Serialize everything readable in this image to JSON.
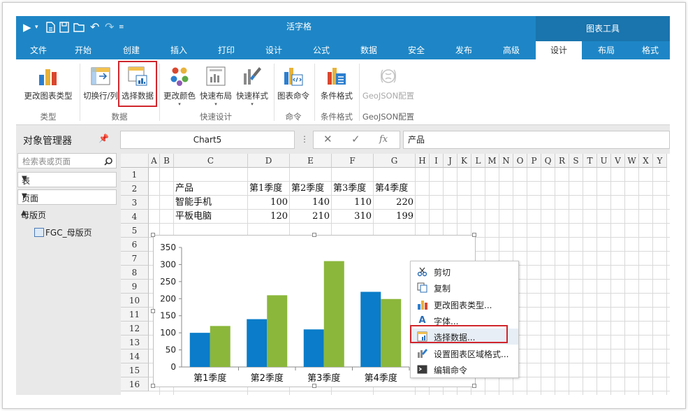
{
  "app": {
    "title": "活字格",
    "context_header": "图表工具"
  },
  "tabs": [
    {
      "label": "文件"
    },
    {
      "label": "开始"
    },
    {
      "label": "创建"
    },
    {
      "label": "插入"
    },
    {
      "label": "打印"
    },
    {
      "label": "设计"
    },
    {
      "label": "公式"
    },
    {
      "label": "数据"
    },
    {
      "label": "安全"
    },
    {
      "label": "发布"
    },
    {
      "label": "高级"
    },
    {
      "label": "设计"
    },
    {
      "label": "布局"
    },
    {
      "label": "格式"
    }
  ],
  "ribbon": {
    "buttons": [
      {
        "label": "更改图表类型"
      },
      {
        "label": "切换行/列"
      },
      {
        "label": "选择数据"
      },
      {
        "label": "更改颜色"
      },
      {
        "label": "快速布局"
      },
      {
        "label": "快速样式"
      },
      {
        "label": "图表命令"
      },
      {
        "label": "条件格式"
      },
      {
        "label": "GeoJSON配置"
      }
    ],
    "groups": [
      {
        "label": "类型"
      },
      {
        "label": "数据"
      },
      {
        "label": "快速设计"
      },
      {
        "label": "命令"
      },
      {
        "label": "条件格式"
      },
      {
        "label": "GeoJSON配置"
      }
    ],
    "dropdown_arrow": "▾"
  },
  "object_manager": {
    "title": "对象管理器",
    "search_placeholder": "检索表或页面",
    "dropdowns": [
      {
        "label": "表"
      },
      {
        "label": "页面"
      }
    ],
    "section": "母版页",
    "item": "FGC_母版页"
  },
  "formula_bar": {
    "name_box": "Chart5",
    "value": "产品",
    "fx": "fx"
  },
  "sheet": {
    "columns": [
      "A",
      "B",
      "C",
      "D",
      "E",
      "F",
      "G",
      "H",
      "I",
      "J",
      "K",
      "L",
      "M",
      "N",
      "O",
      "P",
      "Q",
      "R",
      "S",
      "T",
      "U",
      "V",
      "W",
      "X",
      "Y"
    ],
    "rows": [
      "1",
      "2",
      "3",
      "4",
      "5",
      "6",
      "7",
      "8",
      "9",
      "10",
      "11",
      "12",
      "13",
      "14",
      "15",
      "16"
    ],
    "header": [
      "产品",
      "第1季度",
      "第2季度",
      "第3季度",
      "第4季度"
    ],
    "data": [
      {
        "product": "智能手机",
        "values": [
          "100",
          "140",
          "110",
          "220"
        ]
      },
      {
        "product": "平板电脑",
        "values": [
          "120",
          "210",
          "310",
          "199"
        ]
      }
    ]
  },
  "chart_data": {
    "type": "bar",
    "categories": [
      "第1季度",
      "第2季度",
      "第3季度",
      "第4季度"
    ],
    "series": [
      {
        "values": [
          100,
          140,
          110,
          220
        ],
        "color": "#0a7cc9"
      },
      {
        "values": [
          120,
          210,
          310,
          199
        ],
        "color": "#8bb73b"
      }
    ],
    "ylim": [
      0,
      350
    ],
    "yticks": [
      0,
      50,
      100,
      150,
      200,
      250,
      300,
      350
    ],
    "ytick_labels": [
      "0",
      "50",
      "100",
      "150",
      "200",
      "250",
      "300",
      "350"
    ],
    "grid": false
  },
  "context_menu": {
    "items": [
      {
        "label": "剪切",
        "icon": "scissors-icon"
      },
      {
        "label": "复制",
        "icon": "copy-icon"
      },
      {
        "label": "更改图表类型...",
        "icon": "chart-type-icon"
      },
      {
        "label": "字体...",
        "icon": "font-icon"
      },
      {
        "label": "选择数据...",
        "icon": "select-data-icon"
      },
      {
        "label": "设置图表区域格式...",
        "icon": "format-area-icon"
      },
      {
        "label": "编辑命令",
        "icon": "command-icon"
      }
    ]
  },
  "colors": {
    "accent": "#1e86c6",
    "context_tab": "#1a74ad",
    "highlight": "#d0262c"
  }
}
